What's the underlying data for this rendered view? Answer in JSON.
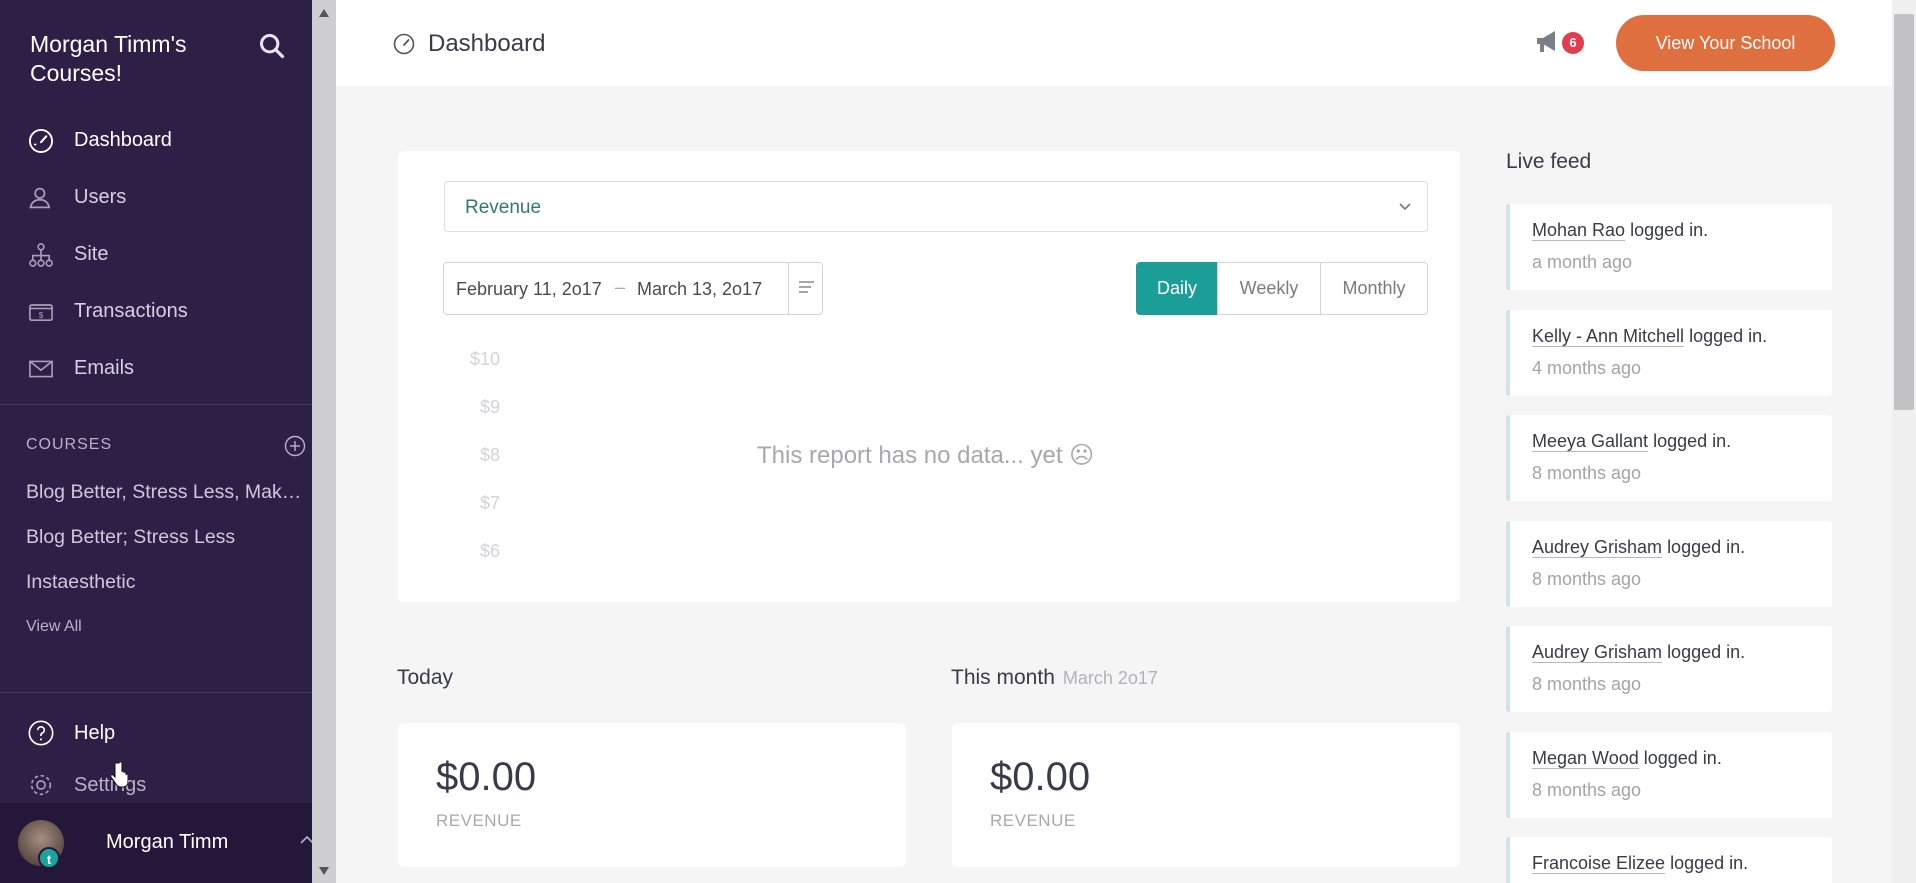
{
  "sidebar": {
    "brand": "Morgan Timm's Courses!",
    "nav": [
      {
        "label": "Dashboard",
        "icon": "dashboard-icon"
      },
      {
        "label": "Users",
        "icon": "users-icon"
      },
      {
        "label": "Site",
        "icon": "site-icon"
      },
      {
        "label": "Transactions",
        "icon": "transactions-icon"
      },
      {
        "label": "Emails",
        "icon": "emails-icon"
      }
    ],
    "courses_heading": "COURSES",
    "courses": [
      "Blog Better, Stress Less, Make Money",
      "Blog Better; Stress Less",
      "Instaesthetic"
    ],
    "view_all": "View All",
    "help": "Help",
    "settings": "Settings",
    "user": {
      "name": "Morgan Timm",
      "badge": "t"
    }
  },
  "header": {
    "title": "Dashboard",
    "notification_count": "6",
    "view_school": "View Your School"
  },
  "report": {
    "selected_metric": "Revenue",
    "date_from": "February 11, 2o17",
    "date_sep": "–",
    "date_to": "March 13, 2o17",
    "periods": [
      "Daily",
      "Weekly",
      "Monthly"
    ],
    "active_period": "Daily",
    "y_ticks": [
      "$10",
      "$9",
      "$8",
      "$7",
      "$6"
    ],
    "empty_message": "This report has no data... yet ☹"
  },
  "stats": {
    "today": {
      "heading": "Today",
      "value": "$0.00",
      "label": "REVENUE"
    },
    "month": {
      "heading": "This month",
      "sub": "March 2o17",
      "value": "$0.00",
      "label": "REVENUE"
    }
  },
  "live_feed": {
    "title": "Live feed",
    "items": [
      {
        "name": "Mohan Rao",
        "action": "logged in.",
        "time": "a month ago"
      },
      {
        "name": "Kelly - Ann Mitchell",
        "action": "logged in.",
        "time": "4 months ago"
      },
      {
        "name": "Meeya Gallant",
        "action": "logged in.",
        "time": "8 months ago"
      },
      {
        "name": "Audrey Grisham",
        "action": "logged in.",
        "time": "8 months ago"
      },
      {
        "name": "Audrey Grisham",
        "action": "logged in.",
        "time": "8 months ago"
      },
      {
        "name": "Megan Wood",
        "action": "logged in.",
        "time": "8 months ago"
      },
      {
        "name": "Francoise Elizee",
        "action": "logged in.",
        "time": ""
      }
    ]
  },
  "colors": {
    "sidebar_bg": "#2e1f47",
    "accent_teal": "#1a9e97",
    "cta_orange": "#e06f3f",
    "badge_red": "#e23d4e"
  }
}
